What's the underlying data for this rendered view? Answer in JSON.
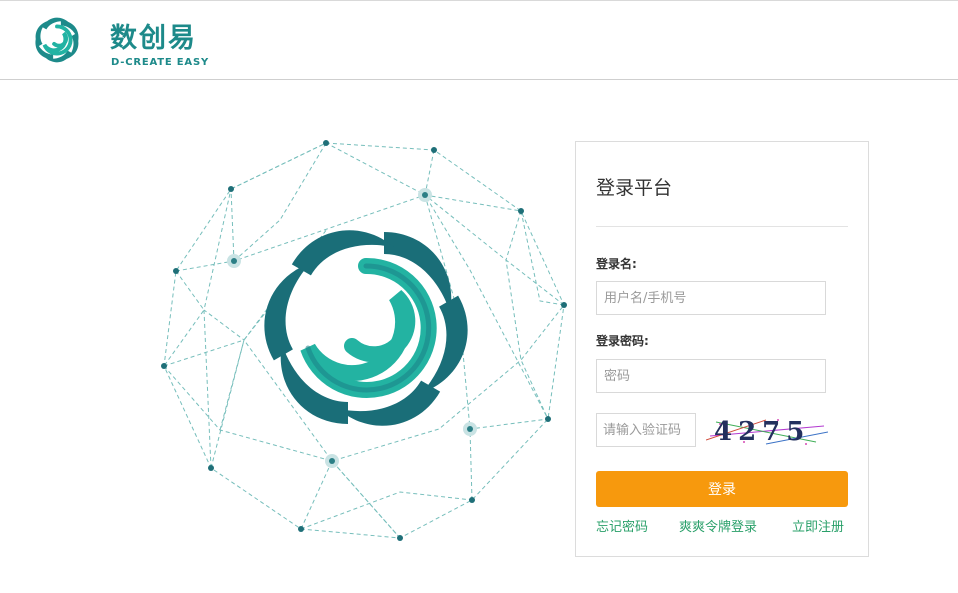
{
  "header": {
    "brand_cn": "数创易",
    "brand_en": "D-CREATE EASY"
  },
  "colors": {
    "brand_teal": "#1d8a8a",
    "accent_orange": "#f7990d",
    "link_green": "#2aa06a"
  },
  "login": {
    "title": "登录平台",
    "username_label": "登录名:",
    "username_placeholder": "用户名/手机号",
    "password_label": "登录密码:",
    "password_placeholder": "密码",
    "captcha_placeholder": "请输入验证码",
    "captcha_code": "4275",
    "submit_label": "登录",
    "forgot_password": "忘记密码",
    "token_login": "爽爽令牌登录",
    "register": "立即注册"
  }
}
